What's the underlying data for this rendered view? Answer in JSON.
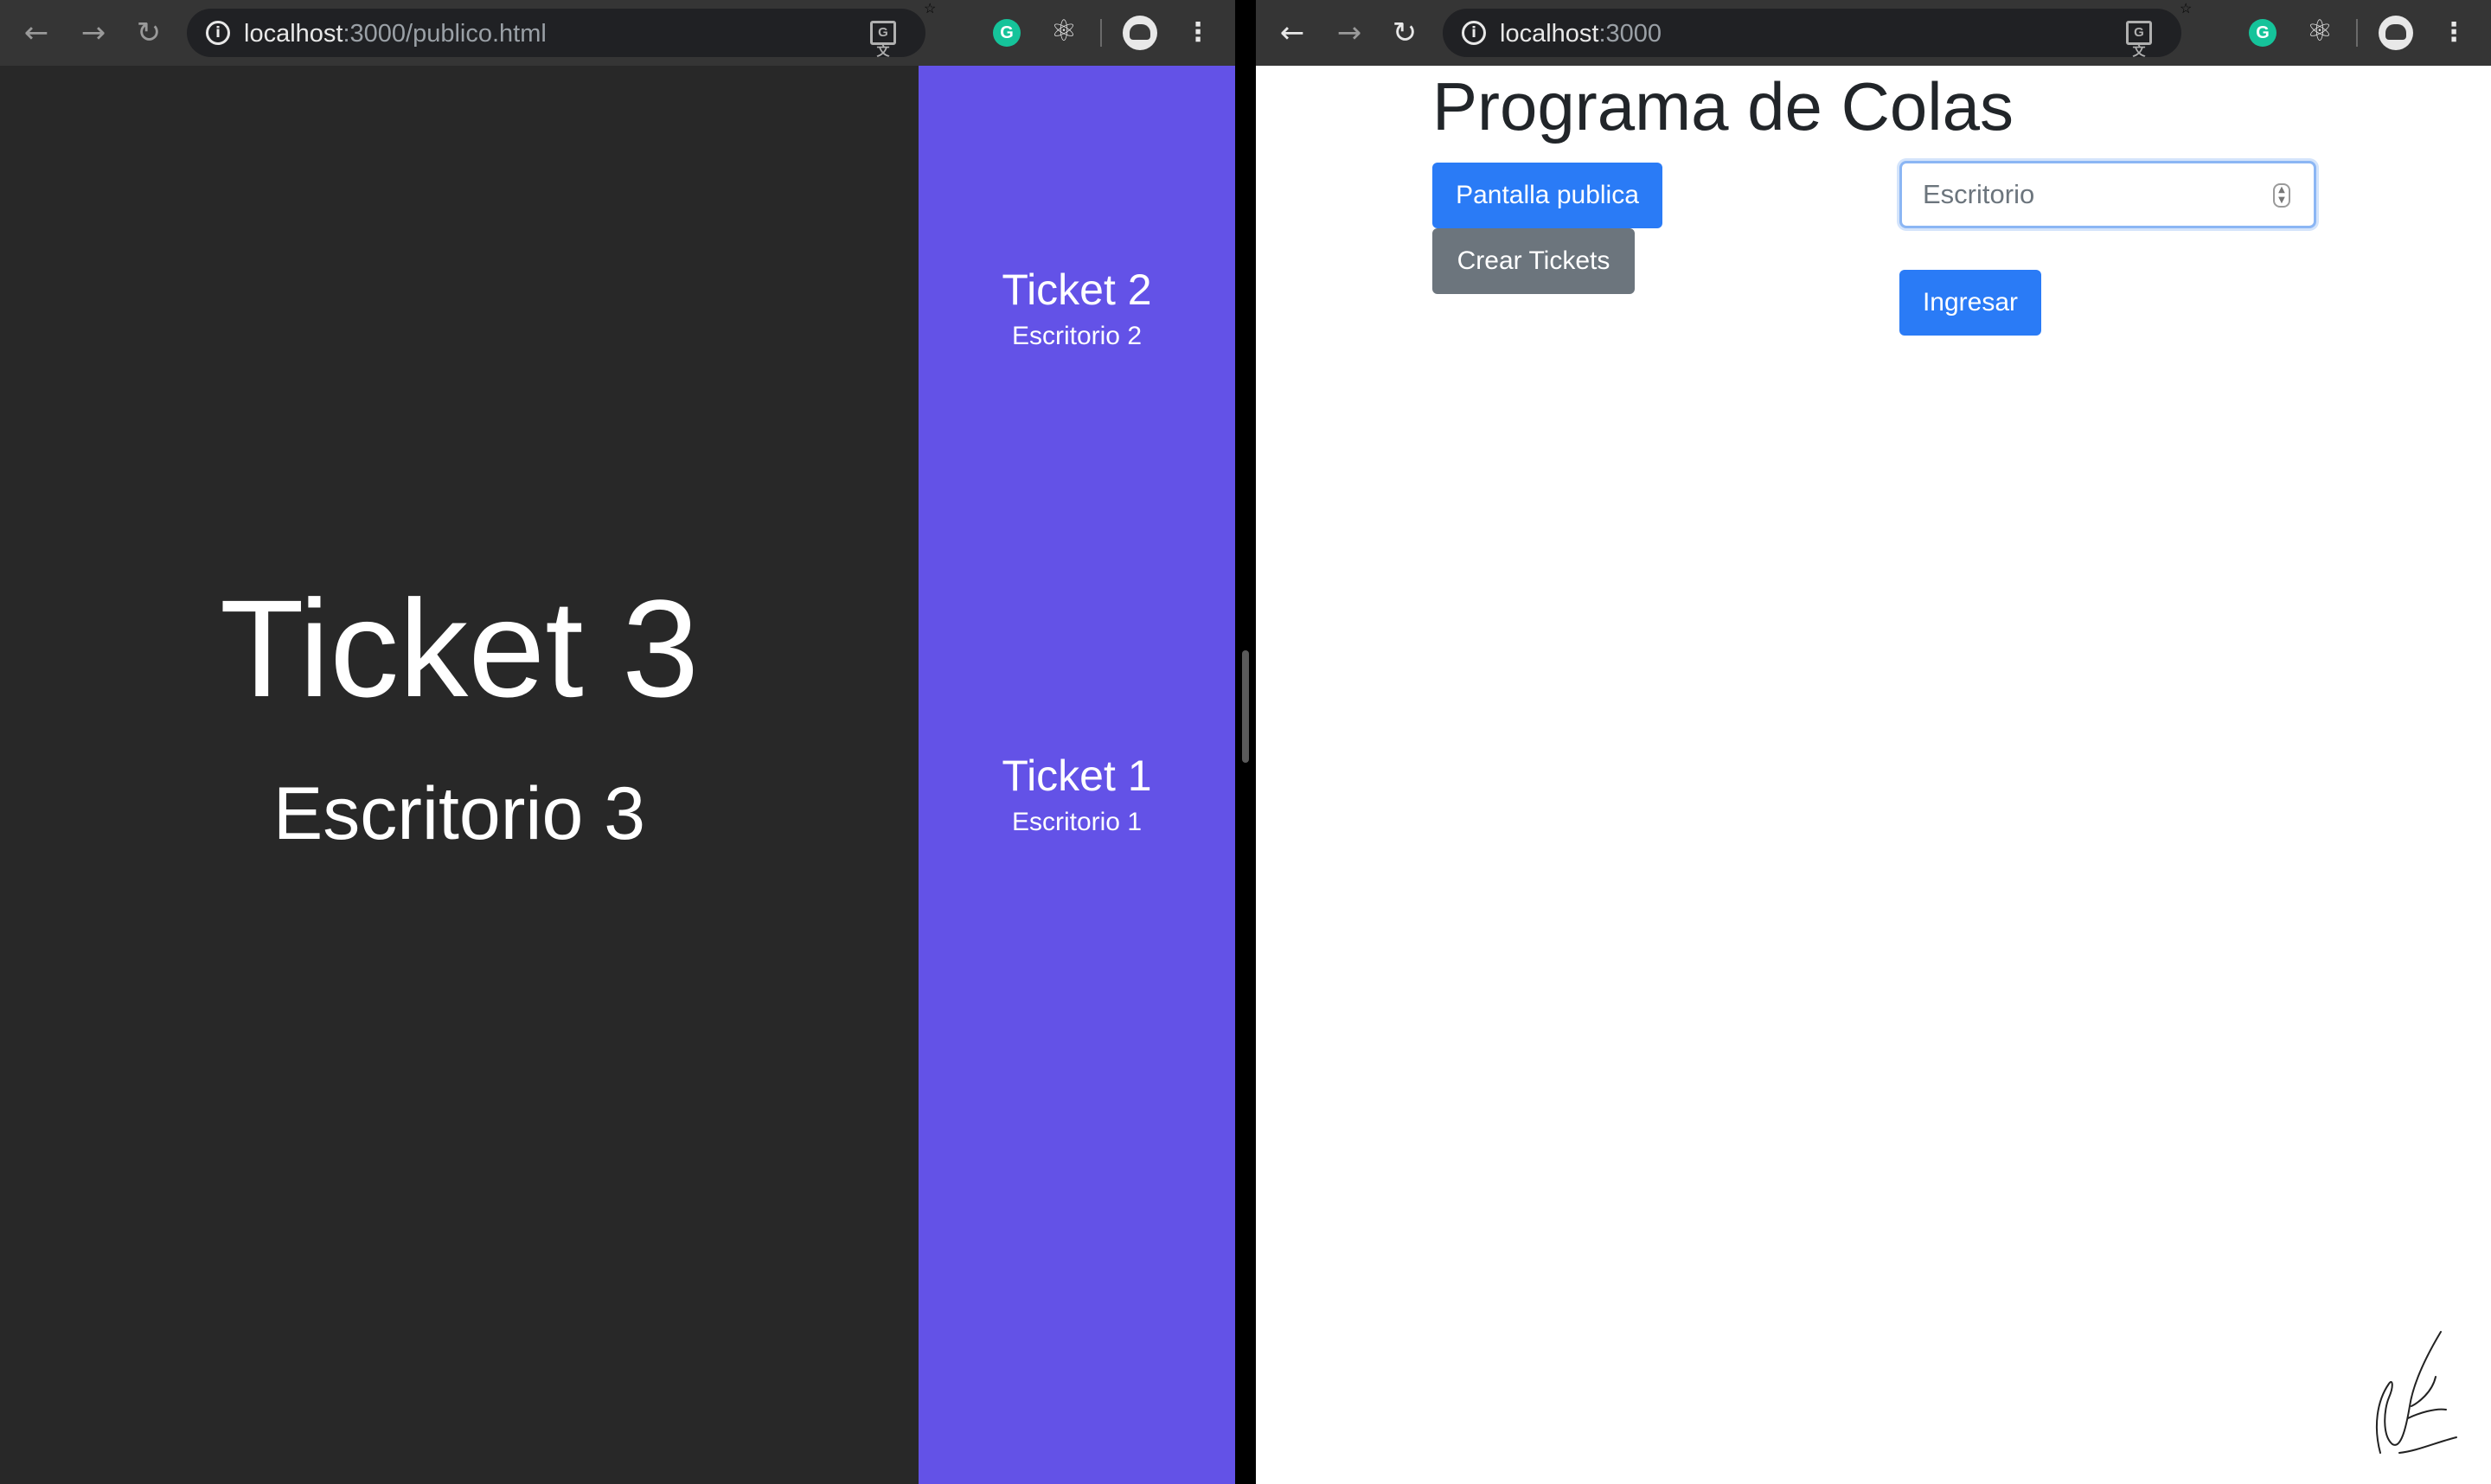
{
  "left_window": {
    "browser": {
      "url_host": "localhost",
      "url_path": ":3000/publico.html",
      "back_icon": "arrow-left-icon",
      "forward_icon": "arrow-right-icon",
      "reload_icon": "reload-icon",
      "info_icon": "i",
      "translate_icon": "G文",
      "bookmark_icon": "☆",
      "grammarly_icon": "G",
      "react_icon": "⚛",
      "menu_icon": "⋮"
    },
    "current": {
      "ticket": "Ticket 3",
      "desk": "Escritorio 3"
    },
    "queue": [
      {
        "ticket": "Ticket 2",
        "desk": "Escritorio 2"
      },
      {
        "ticket": "Ticket 1",
        "desk": "Escritorio 1"
      }
    ],
    "colors": {
      "main_bg": "#282828",
      "side_bg": "#6352e7"
    }
  },
  "right_window": {
    "browser": {
      "url_host": "localhost",
      "url_path": ":3000",
      "back_icon": "arrow-left-icon",
      "forward_icon": "arrow-right-icon",
      "reload_icon": "reload-icon",
      "info_icon": "i",
      "translate_icon": "G文",
      "bookmark_icon": "☆",
      "grammarly_icon": "G",
      "react_icon": "⚛",
      "menu_icon": "⋮"
    },
    "title": "Programa de Colas",
    "buttons": {
      "public_screen": "Pantalla publica",
      "create_tickets": "Crear Tickets",
      "enter": "Ingresar"
    },
    "desk_input": {
      "placeholder": "Escritorio",
      "value": ""
    },
    "colors": {
      "primary": "#2a7bf6",
      "secondary": "#6c757d"
    }
  }
}
